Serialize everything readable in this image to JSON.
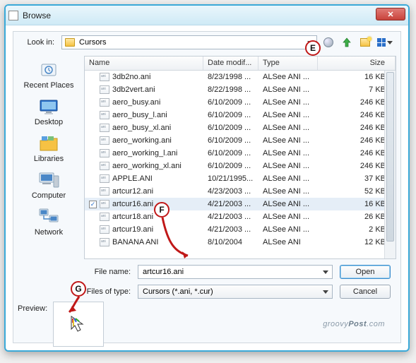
{
  "window": {
    "title": "Browse"
  },
  "lookin": {
    "label": "Look in:",
    "folder": "Cursors"
  },
  "columns": {
    "name": "Name",
    "date": "Date modif...",
    "type": "Type",
    "size": "Size"
  },
  "places": [
    {
      "id": "recent",
      "label": "Recent Places"
    },
    {
      "id": "desktop",
      "label": "Desktop"
    },
    {
      "id": "libraries",
      "label": "Libraries"
    },
    {
      "id": "computer",
      "label": "Computer"
    },
    {
      "id": "network",
      "label": "Network"
    }
  ],
  "files": [
    {
      "name": "3db2no.ani",
      "date": "8/23/1998 ...",
      "type": "ALSee ANI ...",
      "size": "16 KB",
      "selected": false
    },
    {
      "name": "3db2vert.ani",
      "date": "8/22/1998 ...",
      "type": "ALSee ANI ...",
      "size": "7 KB",
      "selected": false
    },
    {
      "name": "aero_busy.ani",
      "date": "6/10/2009 ...",
      "type": "ALSee ANI ...",
      "size": "246 KB",
      "selected": false
    },
    {
      "name": "aero_busy_l.ani",
      "date": "6/10/2009 ...",
      "type": "ALSee ANI ...",
      "size": "246 KB",
      "selected": false
    },
    {
      "name": "aero_busy_xl.ani",
      "date": "6/10/2009 ...",
      "type": "ALSee ANI ...",
      "size": "246 KB",
      "selected": false
    },
    {
      "name": "aero_working.ani",
      "date": "6/10/2009 ...",
      "type": "ALSee ANI ...",
      "size": "246 KB",
      "selected": false
    },
    {
      "name": "aero_working_l.ani",
      "date": "6/10/2009 ...",
      "type": "ALSee ANI ...",
      "size": "246 KB",
      "selected": false
    },
    {
      "name": "aero_working_xl.ani",
      "date": "6/10/2009 ...",
      "type": "ALSee ANI ...",
      "size": "246 KB",
      "selected": false
    },
    {
      "name": "APPLE.ANI",
      "date": "10/21/1995...",
      "type": "ALSee ANI ...",
      "size": "37 KB",
      "selected": false
    },
    {
      "name": "artcur12.ani",
      "date": "4/23/2003 ...",
      "type": "ALSee ANI ...",
      "size": "52 KB",
      "selected": false
    },
    {
      "name": "artcur16.ani",
      "date": "4/21/2003 ...",
      "type": "ALSee ANI ...",
      "size": "16 KB",
      "selected": true
    },
    {
      "name": "artcur18.ani",
      "date": "4/21/2003 ...",
      "type": "ALSee ANI ...",
      "size": "26 KB",
      "selected": false
    },
    {
      "name": "artcur19.ani",
      "date": "4/21/2003 ...",
      "type": "ALSee ANI ...",
      "size": "2 KB",
      "selected": false
    },
    {
      "name": "BANANA ANI",
      "date": "8/10/2004",
      "type": "ALSee ANI",
      "size": "12 KB",
      "selected": false
    }
  ],
  "filename": {
    "label": "File name:",
    "value": "artcur16.ani"
  },
  "filetype": {
    "label": "Files of type:",
    "value": "Cursors (*.ani, *.cur)"
  },
  "buttons": {
    "open": "Open",
    "cancel": "Cancel"
  },
  "preview": {
    "label": "Preview:"
  },
  "annotations": {
    "E": "E",
    "F": "F",
    "G": "G"
  },
  "watermark": {
    "a": "groovy",
    "b": "Post",
    "c": ".com"
  }
}
